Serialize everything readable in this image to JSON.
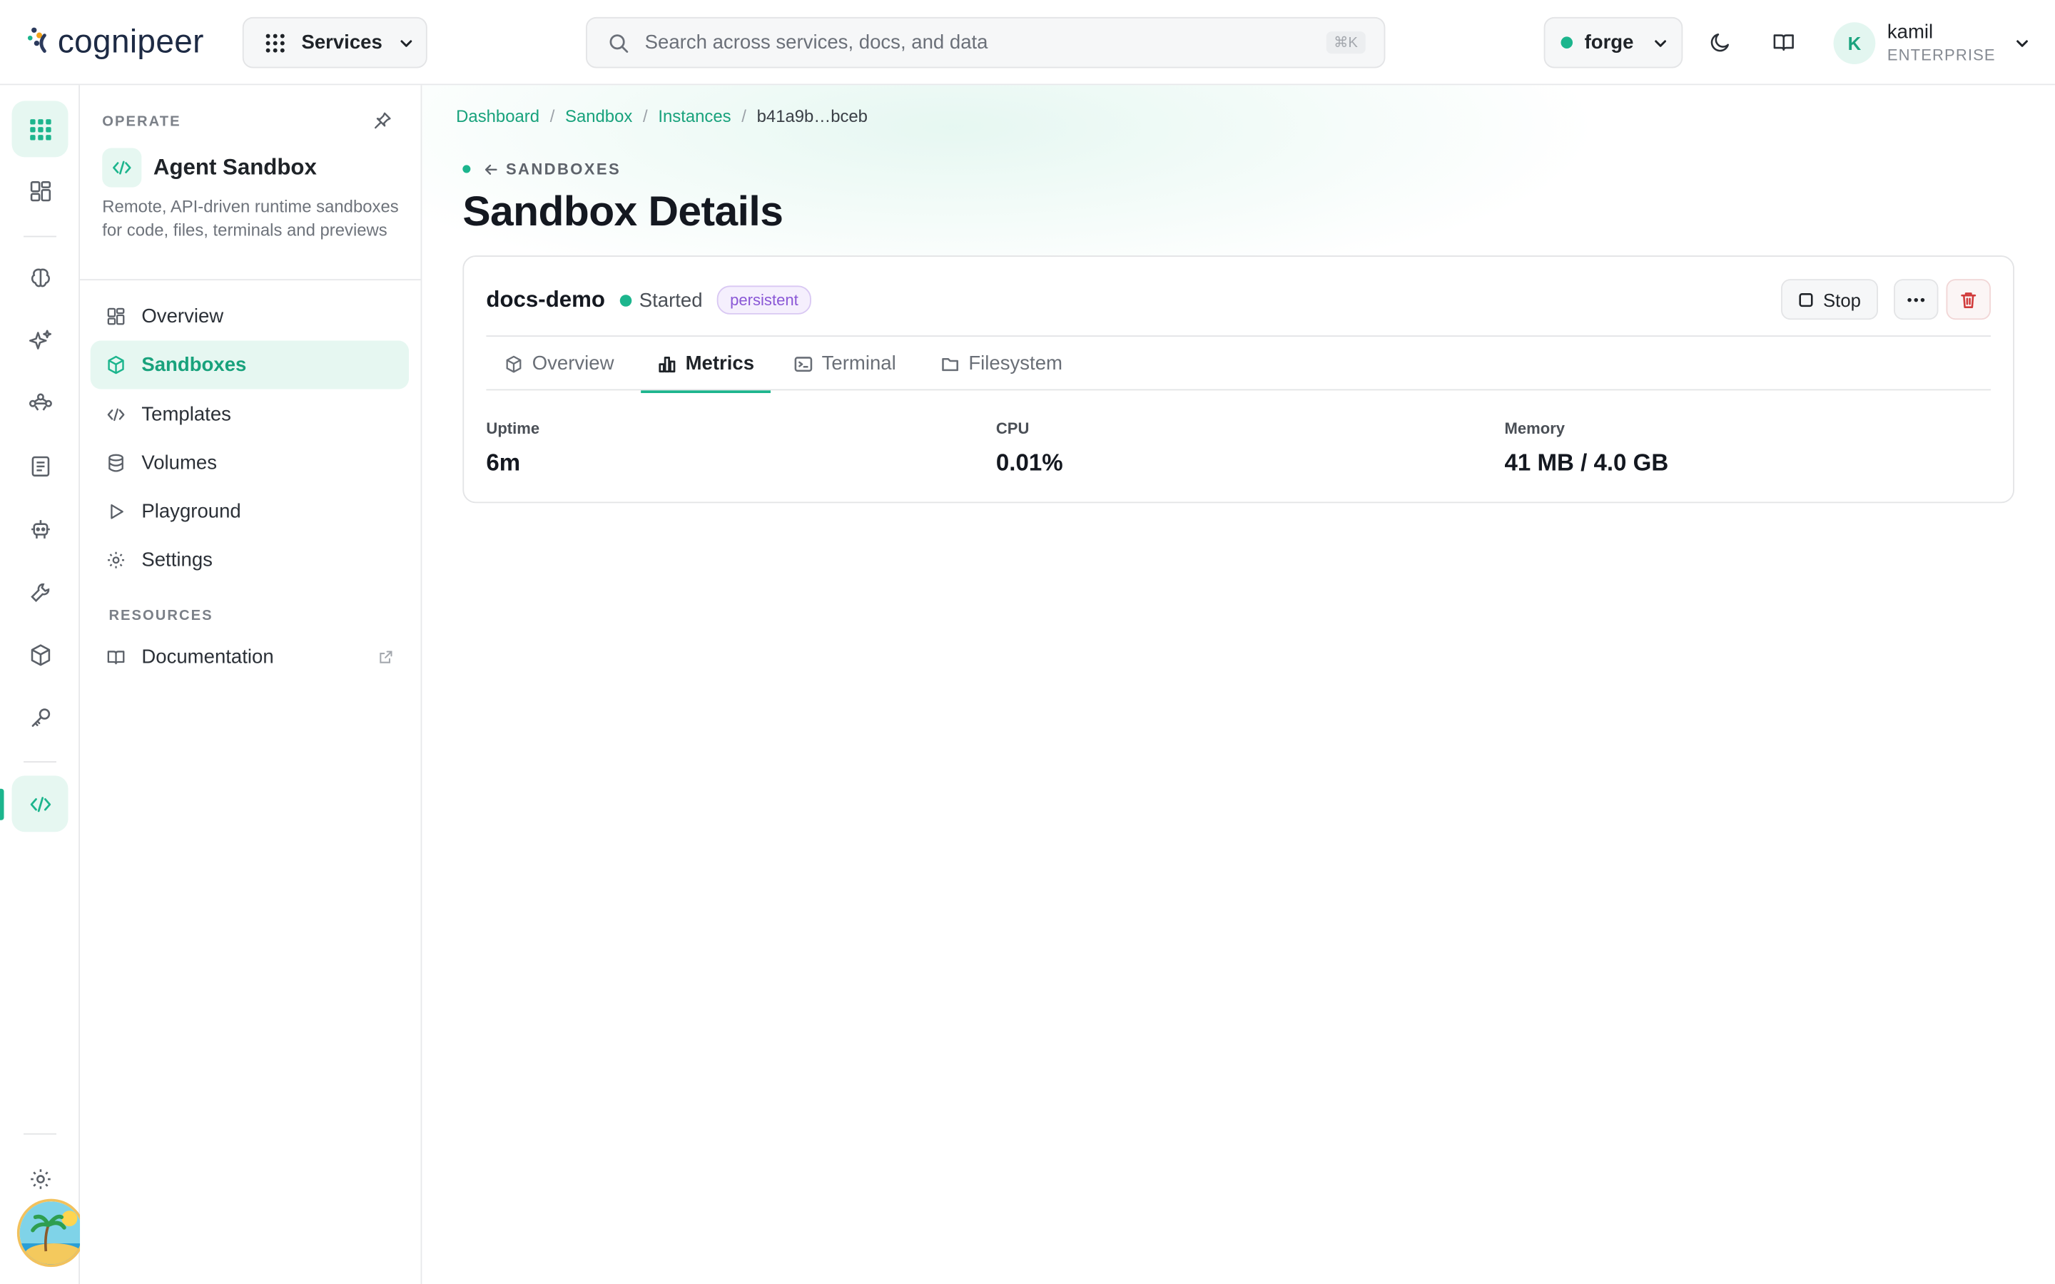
{
  "brand": {
    "name": "cognipeer"
  },
  "topbar": {
    "services_label": "Services",
    "search_placeholder": "Search across services, docs, and data",
    "search_shortcut": "⌘K",
    "environment": "forge",
    "user": {
      "initial": "K",
      "name": "kamil",
      "plan": "ENTERPRISE"
    }
  },
  "rail": {
    "icons": [
      "apps-grid-icon",
      "dashboard-icon",
      "brain-icon",
      "sparkles-icon",
      "workflow-icon",
      "document-icon",
      "robot-icon",
      "tools-icon",
      "cube-icon",
      "key-icon",
      "code-icon",
      "settings-icon"
    ]
  },
  "sidebar": {
    "section_label": "OPERATE",
    "app_title": "Agent Sandbox",
    "app_description": "Remote, API-driven runtime sandboxes for code, files, terminals and previews",
    "items": [
      {
        "label": "Overview",
        "icon": "dashboard-icon"
      },
      {
        "label": "Sandboxes",
        "icon": "cube-icon",
        "active": true
      },
      {
        "label": "Templates",
        "icon": "code-icon"
      },
      {
        "label": "Volumes",
        "icon": "database-icon"
      },
      {
        "label": "Playground",
        "icon": "play-icon"
      },
      {
        "label": "Settings",
        "icon": "gear-icon"
      }
    ],
    "resources_label": "RESOURCES",
    "resources": [
      {
        "label": "Documentation",
        "icon": "book-icon"
      }
    ]
  },
  "breadcrumb": [
    "Dashboard",
    "Sandbox",
    "Instances",
    "b41a9b…bceb"
  ],
  "back_label": "SANDBOXES",
  "page_title": "Sandbox Details",
  "sandbox": {
    "name": "docs-demo",
    "status": "Started",
    "badge": "persistent",
    "stop_label": "Stop",
    "tabs": [
      "Overview",
      "Metrics",
      "Terminal",
      "Filesystem"
    ],
    "active_tab": "Metrics",
    "metrics": [
      {
        "label": "Uptime",
        "value": "6m"
      },
      {
        "label": "CPU",
        "value": "0.01%"
      },
      {
        "label": "Memory",
        "value": "41 MB / 4.0 GB"
      }
    ]
  },
  "colors": {
    "accent": "#1cb58d",
    "accent_text": "#18a27c",
    "badge_purple": "#8a57d6",
    "danger": "#d13b3b"
  }
}
